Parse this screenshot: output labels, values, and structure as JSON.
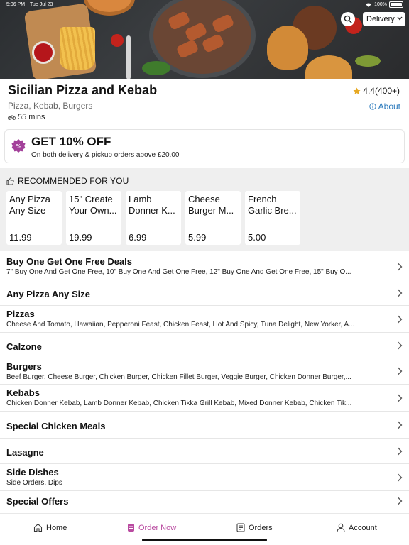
{
  "status_bar": {
    "time": "5:06 PM",
    "date": "Tue Jul 23",
    "battery": "100%"
  },
  "header": {
    "service_mode": "Delivery",
    "icons": [
      "search-icon",
      "chevron-down-icon"
    ]
  },
  "restaurant": {
    "name": "Sicilian Pizza and Kebab",
    "rating": "4.4(400+)",
    "cuisines": "Pizza, Kebab, Burgers",
    "eta": "55 mins",
    "about_label": "About"
  },
  "offer": {
    "title": "GET 10% OFF",
    "subtitle": "On both delivery & pickup orders above £20.00",
    "badge_color": "#a3419a"
  },
  "recommended": {
    "heading": "RECOMMENDED FOR YOU",
    "items": [
      {
        "line1": "Any Pizza",
        "line2": "Any Size",
        "price": "11.99"
      },
      {
        "line1": "15\" Create",
        "line2": "Your Own...",
        "price": "19.99"
      },
      {
        "line1": "Lamb",
        "line2": "Donner K...",
        "price": "6.99"
      },
      {
        "line1": "Cheese",
        "line2": "Burger M...",
        "price": "5.99"
      },
      {
        "line1": "French",
        "line2": "Garlic Bre...",
        "price": "5.00"
      }
    ]
  },
  "categories": [
    {
      "title": "Buy One Get One Free Deals",
      "subtitle": "7\" Buy One And Get One Free, 10\" Buy One And Get One Free, 12\" Buy One And Get One Free, 15\" Buy O..."
    },
    {
      "title": "Any Pizza Any Size",
      "subtitle": ""
    },
    {
      "title": "Pizzas",
      "subtitle": "Cheese And Tomato, Hawaiian, Pepperoni Feast, Chicken Feast, Hot And Spicy, Tuna Delight, New Yorker, A..."
    },
    {
      "title": "Calzone",
      "subtitle": ""
    },
    {
      "title": "Burgers",
      "subtitle": "Beef Burger, Cheese Burger, Chicken Burger, Chicken Fillet Burger, Veggie Burger, Chicken Donner Burger,..."
    },
    {
      "title": "Kebabs",
      "subtitle": "Chicken Donner Kebab, Lamb Donner Kebab, Chicken Tikka Grill Kebab, Mixed Donner Kebab, Chicken Tik..."
    },
    {
      "title": "Special Chicken Meals",
      "subtitle": ""
    },
    {
      "title": "Lasagne",
      "subtitle": ""
    },
    {
      "title": "Side Dishes",
      "subtitle": "Side Orders, Dips"
    },
    {
      "title": "Special Offers",
      "subtitle": ""
    }
  ],
  "bottom_nav": {
    "items": [
      {
        "label": "Home",
        "icon": "home-icon"
      },
      {
        "label": "Order Now",
        "icon": "order-icon"
      },
      {
        "label": "Orders",
        "icon": "receipt-icon"
      },
      {
        "label": "Account",
        "icon": "person-icon"
      }
    ],
    "active_index": 1,
    "active_color": "#b94aa0"
  }
}
